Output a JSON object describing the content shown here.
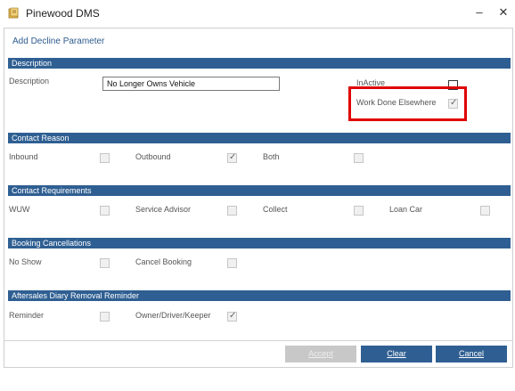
{
  "window": {
    "title": "Pinewood DMS",
    "minimize": "–",
    "close": "✕"
  },
  "dialog": {
    "title": "Add Decline Parameter"
  },
  "sections": {
    "description": "Description",
    "contact_reason": "Contact Reason",
    "contact_requirements": "Contact Requirements",
    "booking_cancellations": "Booking Cancellations",
    "aftersales": "Aftersales Diary Removal Reminder"
  },
  "description": {
    "label": "Description",
    "value": "No Longer Owns Vehicle",
    "inactive_label": "InActive",
    "work_done_label": "Work Done Elsewhere",
    "work_done_checked": true,
    "inactive_checked": false
  },
  "contact_reason": {
    "inbound": "Inbound",
    "outbound": "Outbound",
    "both": "Both",
    "inbound_checked": false,
    "outbound_checked": true,
    "both_checked": false
  },
  "contact_requirements": {
    "wuw": "WUW",
    "service_advisor": "Service Advisor",
    "collect": "Collect",
    "loan_car": "Loan Car",
    "wuw_checked": false,
    "service_advisor_checked": false,
    "collect_checked": false,
    "loan_car_checked": false
  },
  "booking_cancellations": {
    "no_show": "No Show",
    "cancel_booking": "Cancel Booking",
    "no_show_checked": false,
    "cancel_booking_checked": false
  },
  "aftersales": {
    "reminder": "Reminder",
    "owner": "Owner/Driver/Keeper",
    "reminder_checked": false,
    "owner_checked": true
  },
  "buttons": {
    "accept": "Accept",
    "clear": "Clear",
    "cancel": "Cancel"
  },
  "colors": {
    "header": "#2f5f92",
    "highlight": "#e00000"
  },
  "check_glyph": "✓"
}
